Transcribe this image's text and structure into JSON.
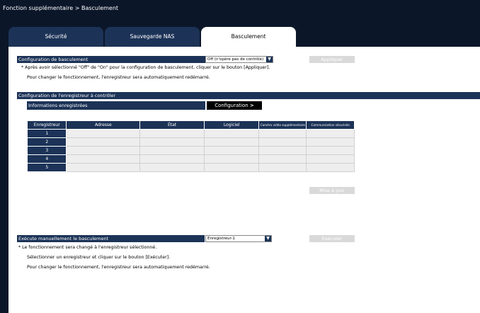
{
  "title": "Fonction supplémentaire > Basculement",
  "tabs": [
    {
      "label": "Sécurité"
    },
    {
      "label": "Sauvegarde NAS"
    },
    {
      "label": "Basculement"
    }
  ],
  "failover_config": {
    "label": "Configuration de basculement",
    "select_value": "Off (n'opère pas de contrôle)",
    "apply_label": "Appliquer",
    "note1": "* Après avoir sélectionné \"Off\" de \"On\" pour la configuration de basculement, cliquer sur le bouton [Appliquer].",
    "note2": "Pour changer le fonctionnement, l'enregistreur sera automatiquement redémarré."
  },
  "recorder_config": {
    "label": "Configuration de l'enregistreur à contrôler",
    "registered_label": "Informations enregistrées",
    "config_button": "Configuration",
    "columns": [
      "Enregistreur",
      "Adresse",
      "État",
      "Logiciel",
      "Caméra vidéo supplémentaire",
      "Communication sécurisée"
    ],
    "rows": [
      "1",
      "2",
      "3",
      "4",
      "5"
    ],
    "update_label": "Mise à jour"
  },
  "manual": {
    "label": "Exécute manuellement le basculement",
    "select_value": "Enregistreur-1",
    "execute_label": "Exécuter",
    "note1": "* Le fonctionnement sera changé à l'enregistreur sélectionné.",
    "note2": "Sélectionner un enregistreur et cliquer sur le bouton [Exécuter].",
    "note3": "Pour changer le fonctionnement, l'enregistreur sera automatiquement redémarré."
  },
  "icons": {
    "dropdown": "chevron-down-icon",
    "arrow": "chevron-right-icon"
  }
}
